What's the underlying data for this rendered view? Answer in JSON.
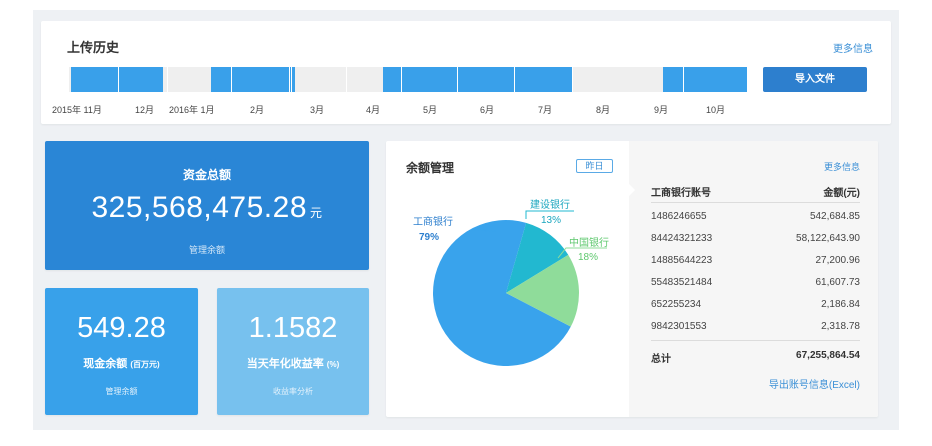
{
  "upload": {
    "title": "上传历史",
    "more": "更多信息",
    "import_label": "导入文件",
    "ticks": [
      "2015年 11月",
      "12月",
      "2016年 1月",
      "2月",
      "3月",
      "4月",
      "5月",
      "6月",
      "7月",
      "8月",
      "9月",
      "10月"
    ]
  },
  "total": {
    "label": "资金总额",
    "amount": "325,568,475.28",
    "unit": "元",
    "sub": "管理余额"
  },
  "cash": {
    "value": "549.28",
    "label": "现金余额",
    "unit": "(百万元)",
    "sub": "管理余额"
  },
  "yield": {
    "value": "1.1582",
    "label": "当天年化收益率",
    "unit": "(%)",
    "sub": "收益率分析"
  },
  "balance": {
    "title": "余额管理",
    "tag": "昨日",
    "colors": {
      "icbc": "#39a3ec",
      "ccb": "#22b8d0",
      "boc": "#8fdc9a"
    },
    "chart_data": {
      "type": "pie",
      "labels": [
        "工商银行",
        "建设银行",
        "中国银行"
      ],
      "values": [
        79,
        13,
        18
      ],
      "value_labels": [
        "79%",
        "13%",
        "18%"
      ]
    }
  },
  "accounts": {
    "more": "更多信息",
    "col_account": "工商银行账号",
    "col_amount": "金额(元)",
    "rows": [
      {
        "account": "1486246655",
        "amount": "542,684.85"
      },
      {
        "account": "84424321233",
        "amount": "58,122,643.90"
      },
      {
        "account": "14885644223",
        "amount": "27,200.96"
      },
      {
        "account": "55483521484",
        "amount": "61,607.73"
      },
      {
        "account": "652255234",
        "amount": "2,186.84"
      },
      {
        "account": "9842301553",
        "amount": "2,318.78"
      }
    ],
    "total_label": "总计",
    "total_amount": "67,255,864.54",
    "export": "导出账号信息(Excel)"
  }
}
